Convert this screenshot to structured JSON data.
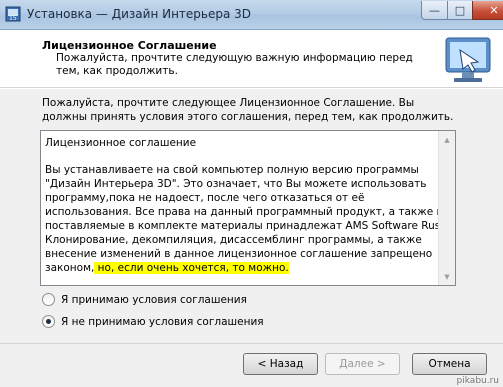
{
  "window": {
    "title": "Установка — Дизайн Интерьера 3D",
    "icon": "installer-app-icon",
    "controls": {
      "minimize": "minimize-icon",
      "maximize": "maximize-icon",
      "close": "close-icon"
    }
  },
  "header": {
    "title": "Лицензионное Соглашение",
    "description": "Пожалуйста, прочтите следующую важную информацию перед тем, как продолжить.",
    "logo": "monitor-setup-logo"
  },
  "body": {
    "instruction": "Пожалуйста, прочтите следующее Лицензионное Соглашение. Вы должны принять условия этого соглашения, перед тем, как продолжить.",
    "license": {
      "title": "Лицензионное соглашение",
      "text_main": "Вы устанавливаете на свой компьютер полную версию программы \"Дизайн Интерьера 3D\". Это означает, что Вы можете использовать программу,пока не надоест, после чего отказаться от её использования. Все права на данный программный продукт, а также на поставляемые в комплекте материалы принадлежат AMS Software Rus. Клонирование, декомпиляция, дисассемблинг программы, а также внесение изменений в данное лицензионное соглашение запрещено законом,",
      "text_highlight": " но, если очень хочется, то можно.",
      "highlight_color": "#ffff00"
    },
    "options": [
      {
        "label": "Я принимаю условия соглашения",
        "checked": false
      },
      {
        "label": "Я не принимаю условия соглашения",
        "checked": true
      }
    ]
  },
  "footer": {
    "back_label": "< Назад",
    "next_label": "Далее >",
    "cancel_label": "Отмена",
    "next_disabled": true
  },
  "watermark": "pikabu.ru"
}
